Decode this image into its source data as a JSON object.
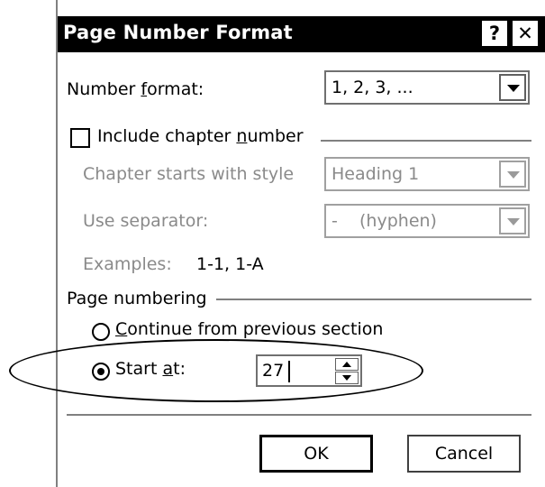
{
  "dialog": {
    "title": "Page Number Format",
    "help_label": "?",
    "close_label": "✕"
  },
  "number_format": {
    "label_before": "Number ",
    "label_accel": "f",
    "label_after": "ormat:",
    "value": "1, 2, 3, ..."
  },
  "chapter": {
    "checkbox_label_before": "Include chapter ",
    "checkbox_label_accel": "n",
    "checkbox_label_after": "umber",
    "checked": false,
    "starts_with_label": "Chapter starts with style",
    "starts_with_value": "Heading 1",
    "separator_label": "Use separator:",
    "separator_value": "-    (hyphen)",
    "examples_label": "Examples:",
    "examples_value": "1-1, 1-A"
  },
  "page_numbering": {
    "group_label": "Page numbering",
    "continue_label_accel": "C",
    "continue_label_after": "ontinue from previous section",
    "start_label_before": "Start ",
    "start_label_accel": "a",
    "start_label_after": "t:",
    "start_value": "27",
    "selected": "start_at"
  },
  "buttons": {
    "ok": "OK",
    "cancel": "Cancel"
  }
}
